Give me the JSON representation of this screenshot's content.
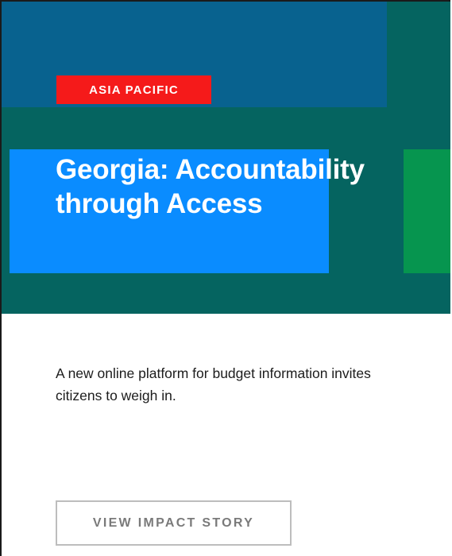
{
  "card": {
    "region": "ASIA PACIFIC",
    "title": "Georgia: Accountability through Access",
    "description": "A new online platform for budget information invites citizens to weigh in.",
    "cta_label": "VIEW IMPACT STORY"
  },
  "colors": {
    "hero_background": "#056460",
    "top_block_blue": "#08628f",
    "bright_block_blue": "#0a8cff",
    "green_block": "#06954f",
    "region_badge_red": "#f51a1a",
    "button_border": "#bdbdbd",
    "button_text": "#7a7a7a"
  }
}
